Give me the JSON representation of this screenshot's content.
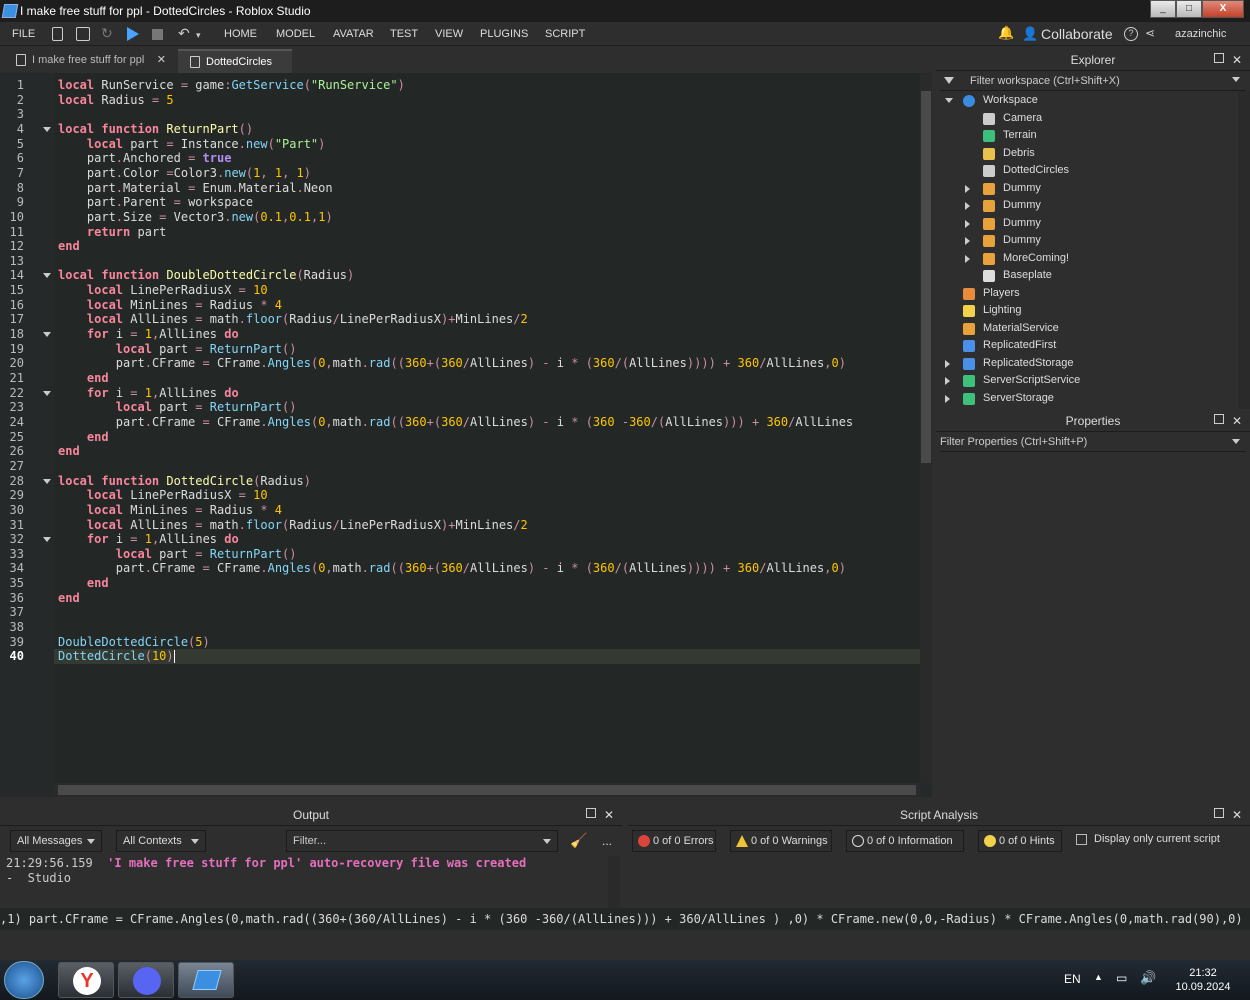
{
  "window": {
    "title": "I make free stuff for ppl - DottedCircles - Roblox Studio",
    "controls": [
      "_",
      "□",
      "X"
    ]
  },
  "menu": {
    "file": "FILE",
    "items": [
      "HOME",
      "MODEL",
      "AVATAR",
      "TEST",
      "VIEW",
      "PLUGINS",
      "SCRIPT"
    ],
    "collaborate": "Collaborate",
    "user": "azazinchic"
  },
  "tabs": [
    {
      "label": "I make free stuff for ppl",
      "active": false
    },
    {
      "label": "DottedCircles",
      "active": true
    }
  ],
  "editor": {
    "current_line": 40,
    "lines": [
      "local RunService = game:GetService(\"RunService\")",
      "local Radius = 5",
      "",
      "local function ReturnPart()",
      "    local part = Instance.new(\"Part\")",
      "    part.Anchored = true",
      "    part.Color =Color3.new(1, 1, 1)",
      "    part.Material = Enum.Material.Neon",
      "    part.Parent = workspace",
      "    part.Size = Vector3.new(0.1,0.1,1)",
      "    return part",
      "end",
      "",
      "local function DoubleDottedCircle(Radius)",
      "    local LinePerRadiusX = 10",
      "    local MinLines = Radius * 4",
      "    local AllLines = math.floor(Radius/LinePerRadiusX)+MinLines/2",
      "    for i = 1,AllLines do",
      "        local part = ReturnPart()",
      "        part.CFrame = CFrame.Angles(0,math.rad((360+(360/AllLines) - i * (360/(AllLines)))) + 360/AllLines,0)",
      "    end",
      "    for i = 1,AllLines do",
      "        local part = ReturnPart()",
      "        part.CFrame = CFrame.Angles(0,math.rad((360+(360/AllLines) - i * (360 -360/(AllLines))) + 360/AllLines",
      "    end",
      "end",
      "",
      "local function DottedCircle(Radius)",
      "    local LinePerRadiusX = 10",
      "    local MinLines = Radius * 4",
      "    local AllLines = math.floor(Radius/LinePerRadiusX)+MinLines/2",
      "    for i = 1,AllLines do",
      "        local part = ReturnPart()",
      "        part.CFrame = CFrame.Angles(0,math.rad((360+(360/AllLines) - i * (360/(AllLines)))) + 360/AllLines,0)",
      "    end",
      "end",
      "",
      "",
      "DoubleDottedCircle(5)",
      "DottedCircle(10)"
    ]
  },
  "explorer": {
    "title": "Explorer",
    "filter_placeholder": "Filter workspace (Ctrl+Shift+X)",
    "items": [
      {
        "label": "Workspace",
        "depth": 0,
        "expander": "down",
        "icon": "globe-icon",
        "color": "#3b8be0"
      },
      {
        "label": "Camera",
        "depth": 1,
        "expander": "",
        "icon": "camera-icon",
        "color": "#cccccc"
      },
      {
        "label": "Terrain",
        "depth": 1,
        "expander": "",
        "icon": "terrain-icon",
        "color": "#3cc07a"
      },
      {
        "label": "Debris",
        "depth": 1,
        "expander": "",
        "icon": "folder-icon",
        "color": "#e8c24c"
      },
      {
        "label": "DottedCircles",
        "depth": 1,
        "expander": "",
        "icon": "script-icon",
        "color": "#cccccc"
      },
      {
        "label": "Dummy",
        "depth": 1,
        "expander": "right",
        "icon": "model-icon",
        "color": "#e8a23c"
      },
      {
        "label": "Dummy",
        "depth": 1,
        "expander": "right",
        "icon": "model-icon",
        "color": "#e8a23c"
      },
      {
        "label": "Dummy",
        "depth": 1,
        "expander": "right",
        "icon": "model-icon",
        "color": "#e8a23c"
      },
      {
        "label": "Dummy",
        "depth": 1,
        "expander": "right",
        "icon": "model-icon",
        "color": "#e8a23c"
      },
      {
        "label": "MoreComing!",
        "depth": 1,
        "expander": "right",
        "icon": "model-icon",
        "color": "#e8a23c"
      },
      {
        "label": "Baseplate",
        "depth": 1,
        "expander": "",
        "icon": "part-icon",
        "color": "#dddddd"
      },
      {
        "label": "Players",
        "depth": 0,
        "expander": "",
        "icon": "players-icon",
        "color": "#e88b3c"
      },
      {
        "label": "Lighting",
        "depth": 0,
        "expander": "",
        "icon": "bulb-icon",
        "color": "#f2d24a"
      },
      {
        "label": "MaterialService",
        "depth": 0,
        "expander": "",
        "icon": "material-icon",
        "color": "#e8a23c"
      },
      {
        "label": "ReplicatedFirst",
        "depth": 0,
        "expander": "",
        "icon": "replicated-icon",
        "color": "#4a8fe8"
      },
      {
        "label": "ReplicatedStorage",
        "depth": 0,
        "expander": "right",
        "icon": "replicated-icon",
        "color": "#4a8fe8"
      },
      {
        "label": "ServerScriptService",
        "depth": 0,
        "expander": "right",
        "icon": "server-script-icon",
        "color": "#3cc07a"
      },
      {
        "label": "ServerStorage",
        "depth": 0,
        "expander": "right",
        "icon": "server-storage-icon",
        "color": "#3cc07a"
      }
    ]
  },
  "properties": {
    "title": "Properties",
    "filter_placeholder": "Filter Properties (Ctrl+Shift+P)"
  },
  "output": {
    "title": "Output",
    "messages_filter": "All Messages",
    "contexts_filter": "All Contexts",
    "filter_placeholder": "Filter...",
    "more": "...",
    "timestamp": "21:29:56.159",
    "message": "'I make free stuff for ppl' auto-recovery file was created",
    "source": "-  Studio"
  },
  "script_analysis": {
    "title": "Script Analysis",
    "errors": "0 of 0 Errors",
    "warnings": "0 of 0 Warnings",
    "information": "0 of 0 Information",
    "hints": "0 of 0 Hints",
    "current_only": "Display only current script"
  },
  "command_bar": ",1) part.CFrame = CFrame.Angles(0,math.rad((360+(360/AllLines) - i * (360 -360/(AllLines))) + 360/AllLines ) ,0) * CFrame.new(0,0,-Radius) * CFrame.Angles(0,math.rad(90),0)  end",
  "taskbar": {
    "language": "EN",
    "time": "21:32",
    "date": "10.09.2024",
    "apps": [
      "yandex-browser-icon",
      "discord-icon",
      "roblox-studio-icon"
    ]
  }
}
